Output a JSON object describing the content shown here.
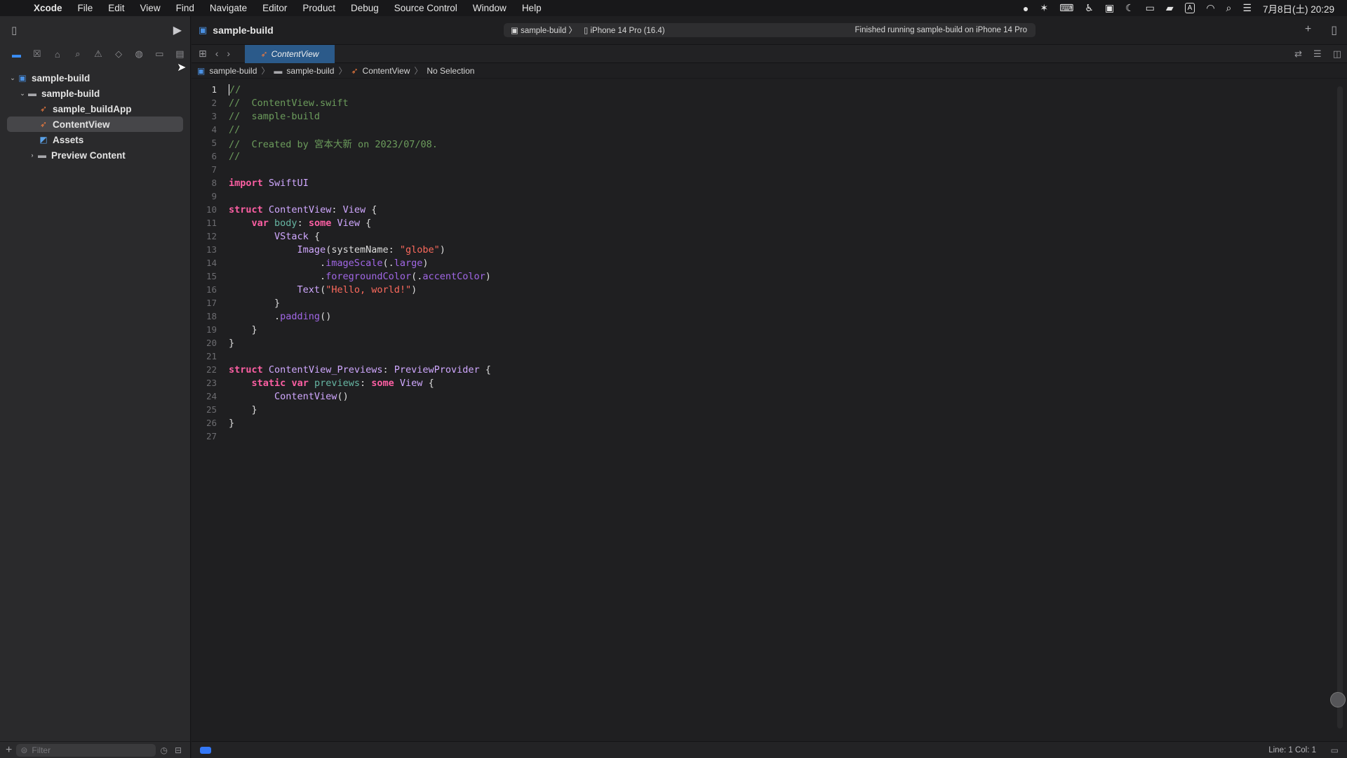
{
  "menubar": {
    "apple_icon": "apple-logo",
    "items": [
      "Xcode",
      "File",
      "Edit",
      "View",
      "Find",
      "Navigate",
      "Editor",
      "Product",
      "Debug",
      "Source Control",
      "Window",
      "Help"
    ],
    "status": {
      "ime": "A",
      "clock": "7月8日(土) 20:29"
    }
  },
  "window": {
    "title": "sample-build",
    "scheme": "sample-build",
    "destination": "iPhone 14 Pro (16.4)",
    "status": "Finished running sample-build on iPhone 14 Pro"
  },
  "tab": {
    "label": "ContentView"
  },
  "jumpbar": {
    "items": [
      "sample-build",
      "sample-build",
      "ContentView",
      "No Selection"
    ]
  },
  "navigator": {
    "items": [
      {
        "label": "sample-build",
        "icon": "project-icon"
      },
      {
        "label": "sample-build",
        "icon": "folder-icon"
      },
      {
        "label": "sample_buildApp",
        "icon": "swift-file-icon"
      },
      {
        "label": "ContentView",
        "icon": "swift-file-icon"
      },
      {
        "label": "Assets",
        "icon": "asset-catalog-icon"
      },
      {
        "label": "Preview Content",
        "icon": "folder-icon"
      }
    ],
    "filter_placeholder": "Filter"
  },
  "code": {
    "lines": [
      "//",
      "//  ContentView.swift",
      "//  sample-build",
      "//",
      "//  Created by 宮本大新 on 2023/07/08.",
      "//",
      "",
      "import SwiftUI",
      "",
      "struct ContentView: View {",
      "    var body: some View {",
      "        VStack {",
      "            Image(systemName: \"globe\")",
      "                .imageScale(.large)",
      "                .foregroundColor(.accentColor)",
      "            Text(\"Hello, world!\")",
      "        }",
      "        .padding()",
      "    }",
      "}",
      "",
      "struct ContentView_Previews: PreviewProvider {",
      "    static var previews: some View {",
      "        ContentView()",
      "    }",
      "}",
      ""
    ],
    "line_numbers": [
      "1",
      "2",
      "3",
      "4",
      "5",
      "6",
      "7",
      "8",
      "9",
      "10",
      "11",
      "12",
      "13",
      "14",
      "15",
      "16",
      "17",
      "18",
      "19",
      "20",
      "21",
      "22",
      "23",
      "24",
      "25",
      "26",
      "27"
    ]
  },
  "statusbar": {
    "position": "Line: 1  Col: 1"
  },
  "colors": {
    "accent": "#3478f6",
    "comment": "#6c9c5c",
    "keyword": "#fc5fa3",
    "string": "#fc6a5d"
  }
}
